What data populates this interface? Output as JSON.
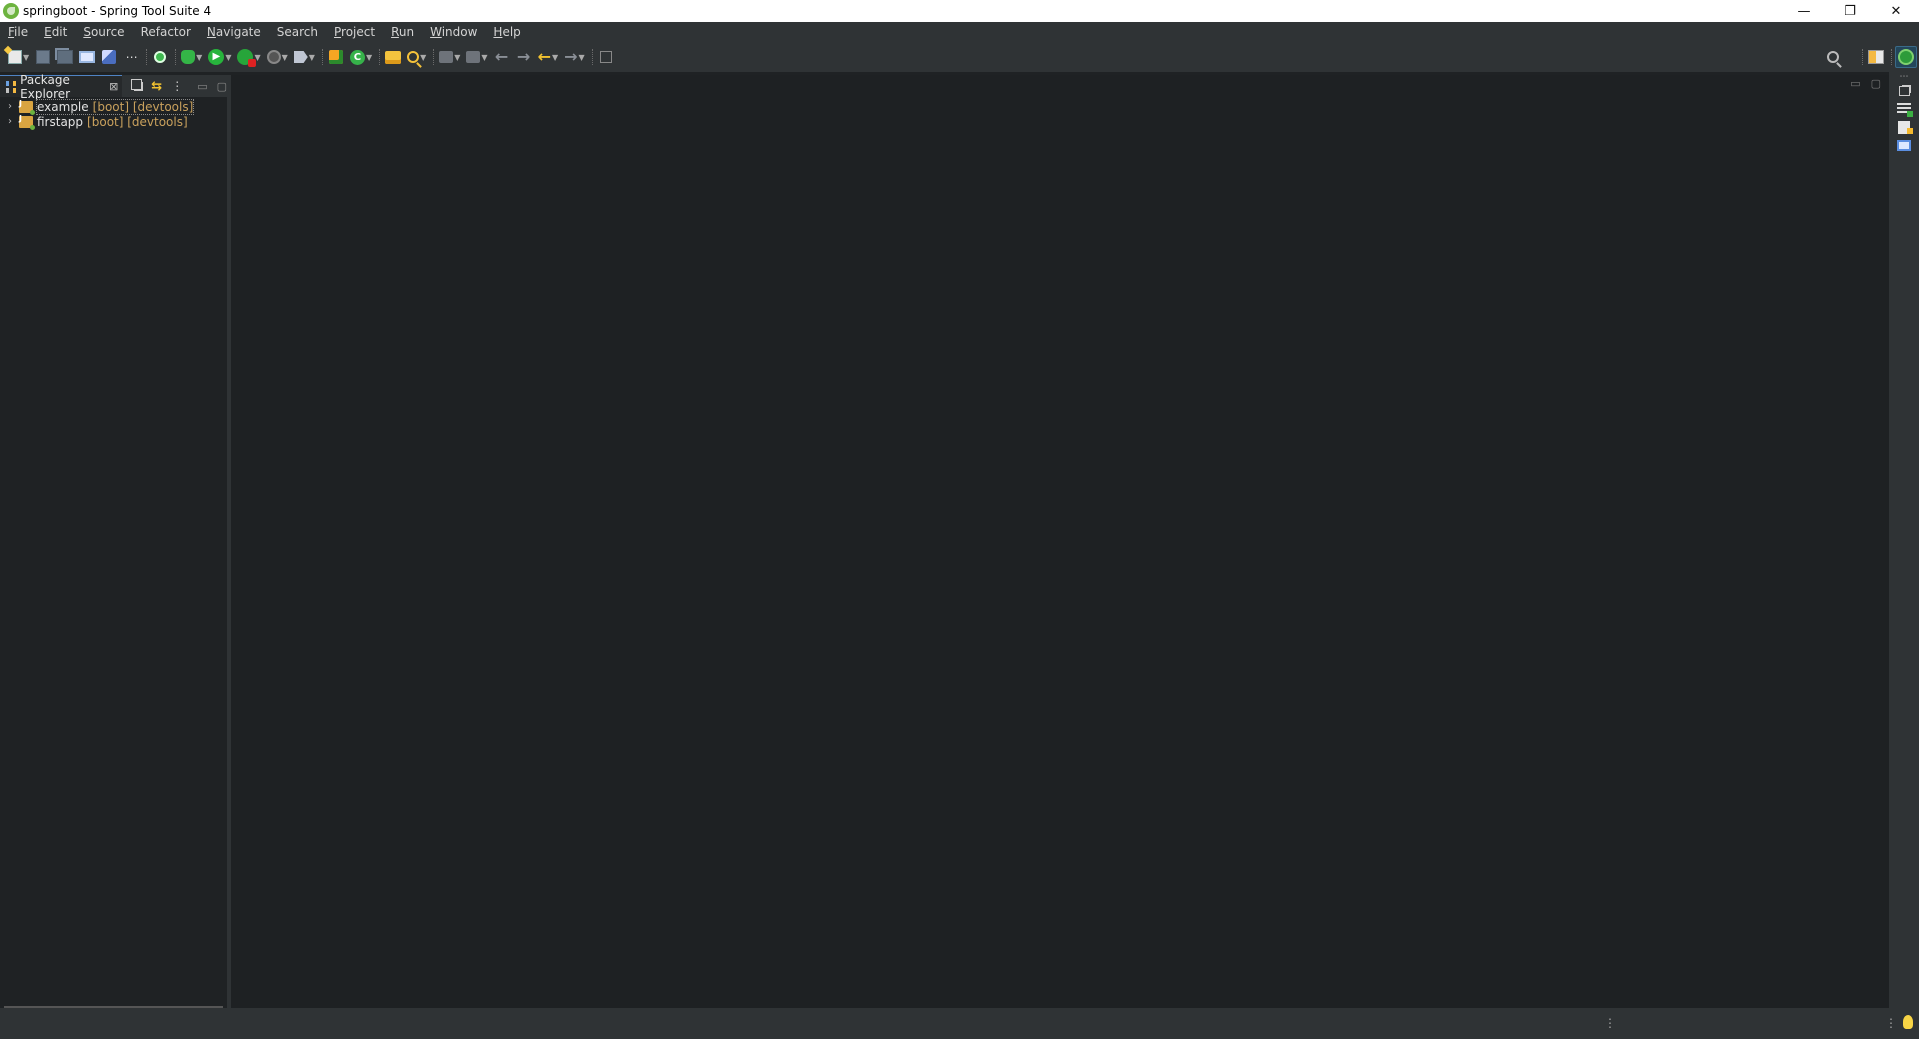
{
  "window": {
    "title": "springboot - Spring Tool Suite 4",
    "controls": {
      "minimize": "—",
      "restore": "❐",
      "close": "✕"
    }
  },
  "menubar": {
    "items": [
      {
        "label": "File",
        "accel": "F",
        "rest": "ile"
      },
      {
        "label": "Edit",
        "accel": "E",
        "rest": "dit"
      },
      {
        "label": "Source",
        "accel": "S",
        "rest": "ource"
      },
      {
        "label": "Refactor",
        "accel": "",
        "rest": "Refactor"
      },
      {
        "label": "Navigate",
        "accel": "N",
        "rest": "avigate"
      },
      {
        "label": "Search",
        "accel": "",
        "rest": "Search"
      },
      {
        "label": "Project",
        "accel": "P",
        "rest": "roject"
      },
      {
        "label": "Run",
        "accel": "R",
        "rest": "un"
      },
      {
        "label": "Window",
        "accel": "W",
        "rest": "indow"
      },
      {
        "label": "Help",
        "accel": "H",
        "rest": "elp"
      }
    ]
  },
  "toolbar": {
    "run_glyph": "▶",
    "class_glyph": "C",
    "back_glyph": "←",
    "forward_glyph": "→",
    "dots_glyph": "⋯",
    "dropdown_glyph": "▼"
  },
  "left_panel": {
    "tab_label": "Package Explorer",
    "tab_close": "⊠",
    "view_menu": "⋮",
    "minimize": "▭",
    "maximize": "▢",
    "link_glyph": "⇆"
  },
  "tree": {
    "expand_glyph": "›",
    "projects": [
      {
        "name": "example",
        "decoration": "[boot] [devtools]",
        "selected": true
      },
      {
        "name": "firstapp",
        "decoration": "[boot] [devtools]",
        "selected": false
      }
    ]
  },
  "editor": {
    "minimize": "▭",
    "maximize": "▢"
  },
  "statusbar": {
    "dots": "⋮"
  },
  "colors": {
    "accent": "#4f83c4",
    "background": "#1f2224",
    "chrome": "#2f3335",
    "decoration": "#c9a15d"
  }
}
